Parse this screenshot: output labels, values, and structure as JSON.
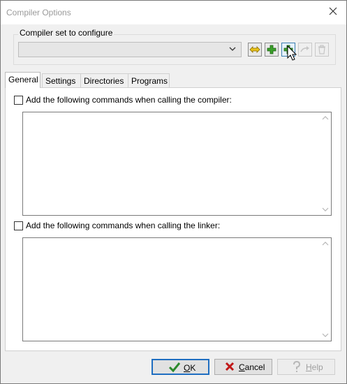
{
  "window": {
    "title": "Compiler Options"
  },
  "compiler_set": {
    "label": "Compiler set to configure",
    "selected": "",
    "tools": [
      "rename-icon",
      "add-icon",
      "add-folder-icon",
      "redo-icon",
      "delete-icon"
    ]
  },
  "tabs": [
    {
      "label": "General",
      "active": true
    },
    {
      "label": "Settings",
      "active": false
    },
    {
      "label": "Directories",
      "active": false
    },
    {
      "label": "Programs",
      "active": false
    }
  ],
  "general": {
    "compiler_check_label": "Add the following commands when calling the compiler:",
    "compiler_checked": false,
    "compiler_commands": "",
    "linker_check_label": "Add the following commands when calling the linker:",
    "linker_checked": false,
    "linker_commands": ""
  },
  "buttons": {
    "ok_prefix": "",
    "ok_underlined": "O",
    "ok_rest": "K",
    "cancel_underlined": "C",
    "cancel_rest": "ancel",
    "help_underlined": "H",
    "help_rest": "elp"
  },
  "colors": {
    "accent": "#1f6ec1",
    "add_green": "#3aa02a",
    "cancel_red": "#c01818",
    "ok_green": "#2c8a2c"
  }
}
